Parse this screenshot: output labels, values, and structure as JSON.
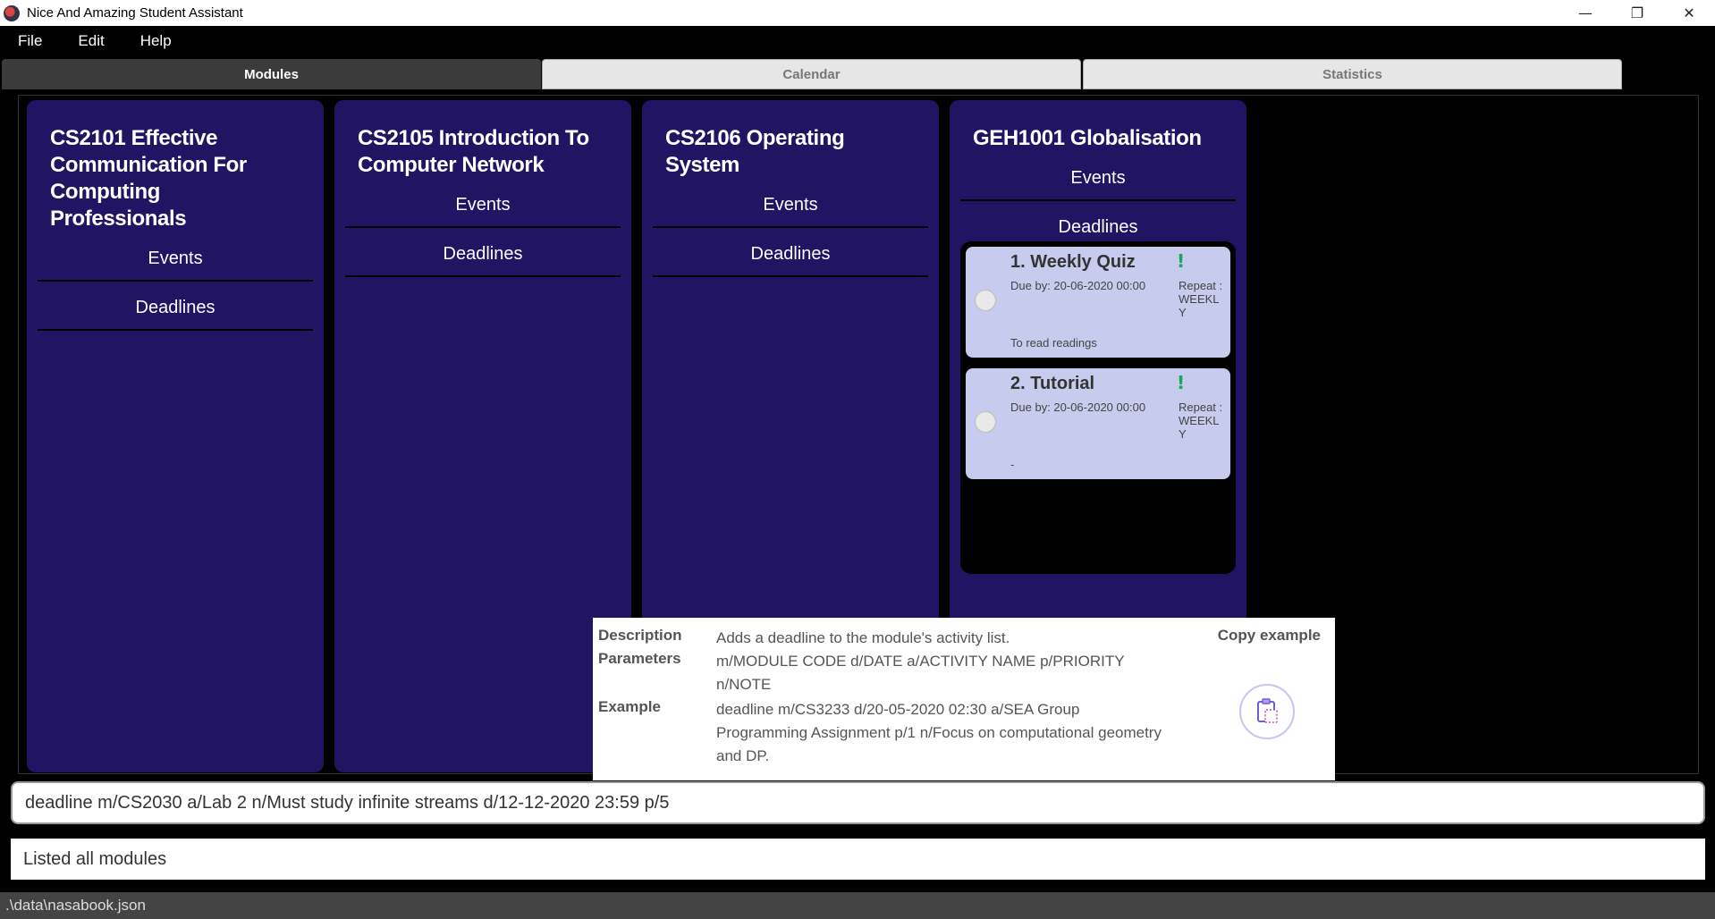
{
  "window": {
    "title": "Nice And Amazing Student Assistant",
    "minimize": "—",
    "maximize": "❐",
    "close": "✕"
  },
  "menu": {
    "file": "File",
    "edit": "Edit",
    "help": "Help"
  },
  "tabs": [
    "Modules",
    "Calendar",
    "Statistics"
  ],
  "active_tab": "Modules",
  "modules": [
    {
      "title": "CS2101 Effective Communication For Computing Professionals",
      "events_label": "Events",
      "deadlines_label": "Deadlines"
    },
    {
      "title": "CS2105 Introduction To Computer Network",
      "events_label": "Events",
      "deadlines_label": "Deadlines"
    },
    {
      "title": "CS2106 Operating System",
      "events_label": "Events",
      "deadlines_label": "Deadlines"
    },
    {
      "title": "GEH1001 Globalisation",
      "events_label": "Events",
      "deadlines_label": "Deadlines"
    }
  ],
  "deadlines": [
    {
      "title": "1. Weekly Quiz",
      "priority": "!",
      "due": "Due by: 20-06-2020 00:00",
      "repeat": "Repeat : WEEKLY",
      "note": "To read readings"
    },
    {
      "title": "2. Tutorial",
      "priority": "!",
      "due": "Due by: 20-06-2020 00:00",
      "repeat": "Repeat : WEEKLY",
      "note": "-"
    }
  ],
  "help": {
    "description_label": "Description",
    "description": "Adds a deadline to the module's activity list.",
    "parameters_label": "Parameters",
    "parameters": "m/MODULE CODE d/DATE a/ACTIVITY NAME p/PRIORITY n/NOTE",
    "example_label": "Example",
    "example": "deadline m/CS3233 d/20-05-2020 02:30 a/SEA Group Programming Assignment p/1 n/Focus on computational geometry and DP.",
    "copy_label": "Copy example"
  },
  "command_input": "deadline m/CS2030 a/Lab 2 n/Must study infinite streams d/12-12-2020 23:59 p/5",
  "result": "Listed all modules",
  "status_path": ".\\data\\nasabook.json",
  "colors": {
    "module_card": "#201463",
    "deadline_card": "#c7cbed",
    "priority": "#1aa65a"
  }
}
